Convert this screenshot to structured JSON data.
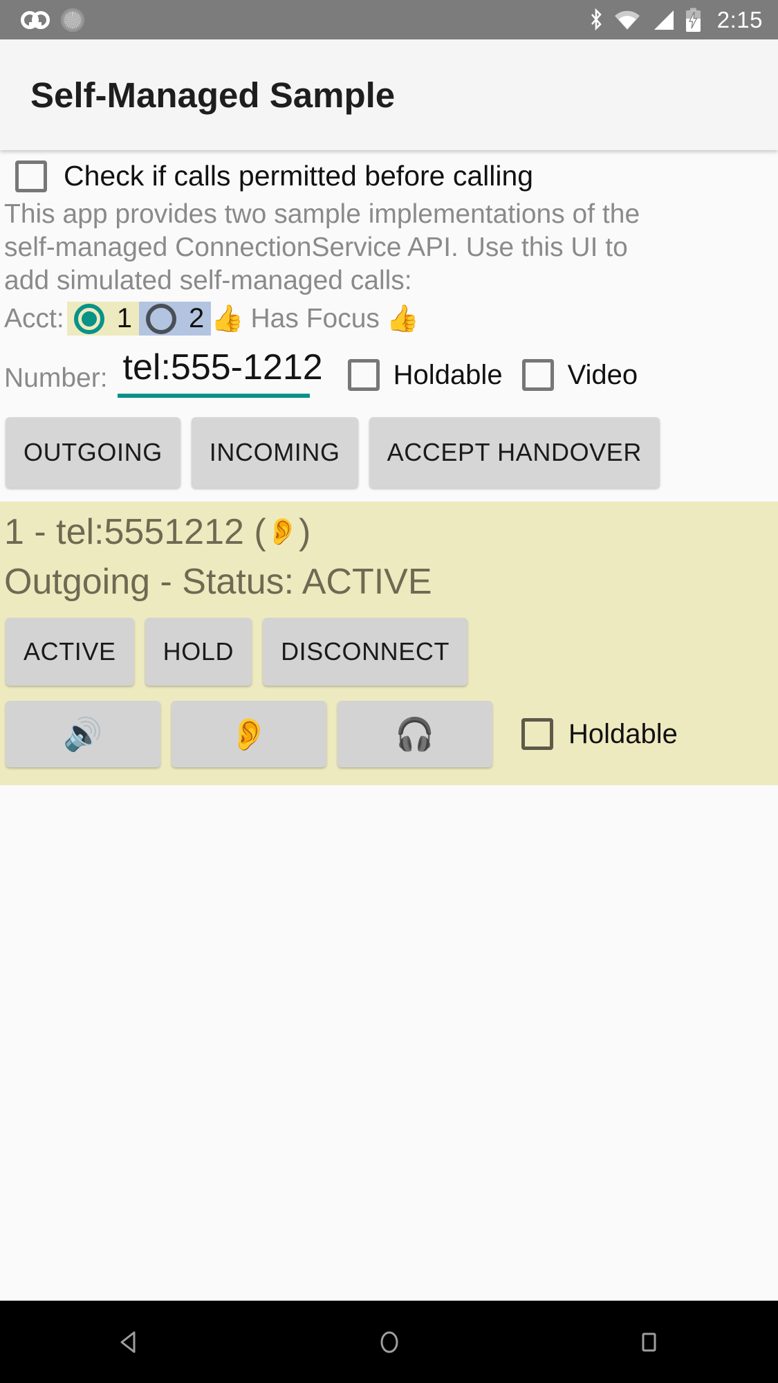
{
  "status_bar": {
    "icons_left": [
      "voicemail-icon",
      "sync-icon"
    ],
    "icons_right": [
      "bluetooth-icon",
      "wifi-icon",
      "signal-icon",
      "battery-charging-icon"
    ],
    "time": "2:15"
  },
  "toolbar": {
    "title": "Self-Managed Sample"
  },
  "permission_check": {
    "label": "Check if calls permitted before calling",
    "checked": false
  },
  "description": "This app provides two sample implementations of the self-managed ConnectionService API.  Use this UI to add simulated self-managed calls:",
  "account_row": {
    "label": "Acct:",
    "options": [
      {
        "value": "1",
        "selected": true
      },
      {
        "value": "2",
        "selected": false
      }
    ],
    "thumb_left": "👍",
    "focus_text": "Has Focus",
    "thumb_right": "👍",
    "selected_bg": "#eeeac0",
    "unselected_bg": "#b3c4e0",
    "accent": "#0a9287"
  },
  "number_row": {
    "label": "Number:",
    "value": "tel:555-1212",
    "placeholder": "tel:555-1212",
    "underline_color": "#0a9287",
    "holdable": {
      "label": "Holdable",
      "checked": false
    },
    "video": {
      "label": "Video",
      "checked": false
    }
  },
  "actions": [
    {
      "label": "OUTGOING"
    },
    {
      "label": "INCOMING"
    },
    {
      "label": "ACCEPT HANDOVER"
    }
  ],
  "call_card": {
    "background": "#eeeac0",
    "title": "1 - tel:5551212 ( ",
    "title_icon": "👂",
    "title_suffix": " )",
    "status": "Outgoing - Status: ACTIVE",
    "state_buttons": [
      {
        "label": "ACTIVE"
      },
      {
        "label": "HOLD"
      },
      {
        "label": "DISCONNECT"
      }
    ],
    "audio_buttons": [
      {
        "icon": "🔊",
        "name": "speaker"
      },
      {
        "icon": "👂",
        "name": "earpiece"
      },
      {
        "icon": "🎧",
        "name": "headset"
      }
    ],
    "holdable": {
      "label": "Holdable",
      "checked": false
    }
  },
  "nav_bar": {
    "buttons": [
      "back-icon",
      "home-icon",
      "recents-icon"
    ]
  }
}
